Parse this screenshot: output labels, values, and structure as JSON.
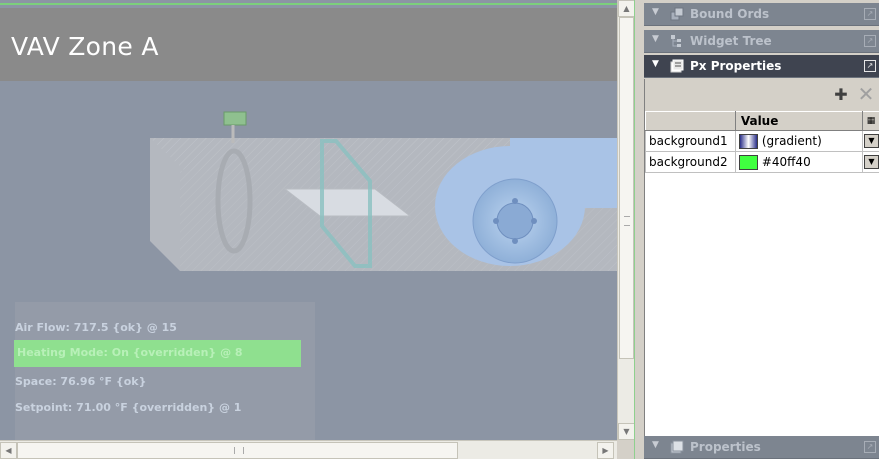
{
  "canvas": {
    "title": "VAV Zone A",
    "status": {
      "air_flow": "Air Flow: 717.5 {ok} @ 15",
      "heating_mode": "Heating Mode: On {overridden} @ 8",
      "space": "Space: 76.96 °F {ok}",
      "setpoint": "Setpoint: 71.00 °F {overridden} @ 1"
    }
  },
  "side_panel": {
    "panes": [
      {
        "label": "Bound Ords",
        "icon": "bound-ords-icon",
        "active": false
      },
      {
        "label": "Widget Tree",
        "icon": "widget-tree-icon",
        "active": false
      },
      {
        "label": "Px Properties",
        "icon": "px-properties-icon",
        "active": true
      },
      {
        "label": "Properties",
        "icon": "properties-icon",
        "active": false
      }
    ],
    "px_properties": {
      "columns": [
        "",
        "Value"
      ],
      "rows": [
        {
          "name": "background1",
          "value": "(gradient)",
          "swatch_color": "#4a4fb0"
        },
        {
          "name": "background2",
          "value": "#40ff40",
          "swatch_color": "#40ff40"
        }
      ]
    }
  },
  "colors": {
    "canvas_bg": "#8c95a4",
    "title_bar": "#8a8a8a",
    "active_pane_header": "#3f4450",
    "heating_highlight": "#8fe08f"
  }
}
